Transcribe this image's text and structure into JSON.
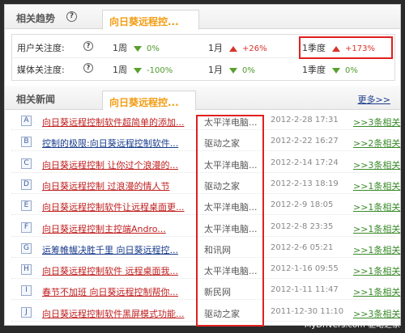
{
  "trend": {
    "title": "相关趋势",
    "tab": "向日葵远程控...",
    "rows": [
      {
        "label": "用户关注度:",
        "cells": [
          {
            "period": "1周",
            "dir": "down",
            "pct": "0%"
          },
          {
            "period": "1月",
            "dir": "up",
            "pct": "+26%"
          },
          {
            "period": "1季度",
            "dir": "up",
            "pct": "+173%"
          }
        ]
      },
      {
        "label": "媒体关注度:",
        "cells": [
          {
            "period": "1周",
            "dir": "down",
            "pct": "-100%"
          },
          {
            "period": "1月",
            "dir": "down",
            "pct": "0%"
          },
          {
            "period": "1季度",
            "dir": "down",
            "pct": "0%"
          }
        ]
      }
    ]
  },
  "news": {
    "title": "相关新闻",
    "tab": "向日葵远程控...",
    "more": "更多>>",
    "items": [
      {
        "letter": "A",
        "title": "向日葵远程控制软件超简单的添加...",
        "source": "太平洋电脑...",
        "date": "2012-2-28 17:31",
        "related": ">>3条相关",
        "color": "red"
      },
      {
        "letter": "B",
        "title": "控制的极限:向日葵远程控制软件...",
        "source": "驱动之家",
        "date": "2012-2-22 16:27",
        "related": ">>2条相关",
        "color": "blue"
      },
      {
        "letter": "C",
        "title": "向日葵远程控制 让你过个浪漫的...",
        "source": "太平洋电脑...",
        "date": "2012-2-14 17:24",
        "related": ">>3条相关",
        "color": "red"
      },
      {
        "letter": "D",
        "title": "向日葵远程控制 过浪漫的情人节",
        "source": "驱动之家",
        "date": "2012-2-13 18:19",
        "related": ">>1条相关",
        "color": "red"
      },
      {
        "letter": "E",
        "title": "向日葵远程控制软件让远程桌面更...",
        "source": "太平洋电脑...",
        "date": "2012-2-9 18:05",
        "related": ">>1条相关",
        "color": "red"
      },
      {
        "letter": "F",
        "title": "向日葵远程控制主控端Andro...",
        "source": "太平洋电脑...",
        "date": "2012-2-8 23:35",
        "related": ">>1条相关",
        "color": "red"
      },
      {
        "letter": "G",
        "title": "运筹帷幄决胜千里 向日葵远程控...",
        "source": "和讯网",
        "date": "2012-2-6 05:21",
        "related": ">>1条相关",
        "color": "blue"
      },
      {
        "letter": "H",
        "title": "向日葵远程控制软件 远程桌面我...",
        "source": "太平洋电脑...",
        "date": "2012-1-16 09:55",
        "related": ">>1条相关",
        "color": "red"
      },
      {
        "letter": "I",
        "title": "春节不加班 向日葵远程控制帮你...",
        "source": "新民网",
        "date": "2012-1-11 11:47",
        "related": ">>1条相关",
        "color": "red"
      },
      {
        "letter": "J",
        "title": "向日葵远程控制软件黑屏模式功能...",
        "source": "驱动之家",
        "date": "2011-12-30 11:10",
        "related": ">>3条相关",
        "color": "red"
      }
    ]
  },
  "watermark": "MyDrivers.com 驱动之家"
}
